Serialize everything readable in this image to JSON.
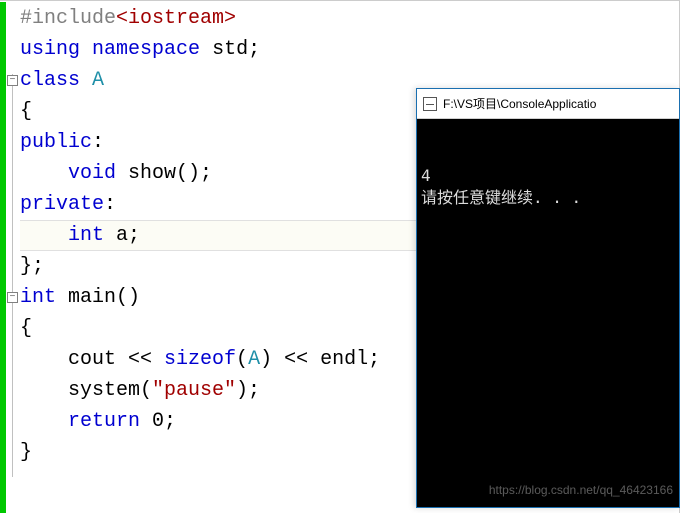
{
  "editor": {
    "current_line_index": 7,
    "fold_markers": [
      {
        "line": 2,
        "symbol": "−"
      },
      {
        "line": 9,
        "symbol": "−"
      }
    ],
    "lines": [
      [
        {
          "cls": "pp",
          "t": "#include"
        },
        {
          "cls": "inc",
          "t": "<iostream>"
        }
      ],
      [
        {
          "cls": "kw",
          "t": "using"
        },
        {
          "cls": "",
          "t": " "
        },
        {
          "cls": "kw",
          "t": "namespace"
        },
        {
          "cls": "",
          "t": " std;"
        }
      ],
      [
        {
          "cls": "kw",
          "t": "class"
        },
        {
          "cls": "",
          "t": " "
        },
        {
          "cls": "typ",
          "t": "A"
        }
      ],
      [
        {
          "cls": "",
          "t": "{"
        }
      ],
      [
        {
          "cls": "kw",
          "t": "public"
        },
        {
          "cls": "",
          "t": ":"
        }
      ],
      [
        {
          "cls": "",
          "t": "    "
        },
        {
          "cls": "kw",
          "t": "void"
        },
        {
          "cls": "",
          "t": " show();"
        }
      ],
      [
        {
          "cls": "kw",
          "t": "private"
        },
        {
          "cls": "",
          "t": ":"
        }
      ],
      [
        {
          "cls": "",
          "t": "    "
        },
        {
          "cls": "kw",
          "t": "int"
        },
        {
          "cls": "",
          "t": " a;"
        }
      ],
      [
        {
          "cls": "",
          "t": "};"
        }
      ],
      [
        {
          "cls": "kw",
          "t": "int"
        },
        {
          "cls": "",
          "t": " main()"
        }
      ],
      [
        {
          "cls": "",
          "t": "{"
        }
      ],
      [
        {
          "cls": "",
          "t": "    cout << "
        },
        {
          "cls": "kw",
          "t": "sizeof"
        },
        {
          "cls": "",
          "t": "("
        },
        {
          "cls": "typ",
          "t": "A"
        },
        {
          "cls": "",
          "t": ") << endl;"
        }
      ],
      [
        {
          "cls": "",
          "t": "    system("
        },
        {
          "cls": "str",
          "t": "\"pause\""
        },
        {
          "cls": "",
          "t": ");"
        }
      ],
      [
        {
          "cls": "",
          "t": "    "
        },
        {
          "cls": "kw",
          "t": "return"
        },
        {
          "cls": "",
          "t": " 0;"
        }
      ],
      [
        {
          "cls": "",
          "t": "}"
        }
      ]
    ]
  },
  "console": {
    "title": "F:\\VS项目\\ConsoleApplicatio",
    "output_lines": [
      "4",
      "请按任意键继续. . ."
    ]
  },
  "watermark": "https://blog.csdn.net/qq_46423166"
}
